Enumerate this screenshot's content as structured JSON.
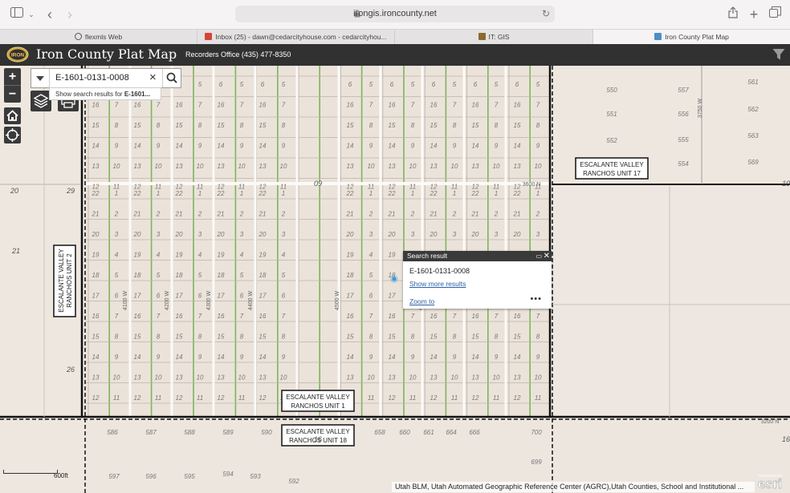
{
  "browser": {
    "url": "irongis.ironcounty.net",
    "tabs": [
      {
        "label": "flexmls Web"
      },
      {
        "label": "Inbox (25) - dawn@cedarcityhouse.com - cedarcityhou..."
      },
      {
        "label": "IT: GIS"
      },
      {
        "label": "Iron County Plat Map"
      }
    ]
  },
  "header": {
    "logo_text": "IRON",
    "title": "Iron County Plat Map",
    "subtitle": "Recorders Office (435) 477-8350"
  },
  "search": {
    "value": "E-1601-0131-0008",
    "suggestion_prefix": "Show search results for ",
    "suggestion_term": "E-1601..."
  },
  "popup": {
    "header": "Search result",
    "title": "E-1601-0131-0008",
    "more_link": "Show more results",
    "zoom_link": "Zoom to",
    "menu": "•••"
  },
  "map": {
    "subdivision_labels": [
      {
        "line1": "ESCALANTE VALLEY",
        "line2": "RANCHOS UNIT 17"
      },
      {
        "line1": "ESCALANTE VALLEY",
        "line2": "RANCHOS UNIT 2"
      },
      {
        "line1": "ESCALANTE VALLEY",
        "line2": "RANCHOS UNIT 1"
      },
      {
        "line1": "ESCALANTE VALLEY",
        "line2": "RANCHOS UNIT 18"
      }
    ],
    "section_numbers": [
      "20",
      "29",
      "21",
      "28",
      "26",
      "09",
      "16"
    ],
    "lot_numbers_unit17": [
      "561",
      "550",
      "557",
      "562",
      "551",
      "556",
      "563",
      "552",
      "555",
      "554",
      "569"
    ],
    "lot_numbers_unit18": [
      "586",
      "587",
      "588",
      "589",
      "590",
      "658",
      "660",
      "661",
      "664",
      "666",
      "700",
      "699",
      "597",
      "596",
      "595",
      "594",
      "593",
      "592"
    ],
    "road_labels": [
      "3600 N",
      "3200 N",
      "3750 W",
      "4100 W",
      "4200 W",
      "4300 W",
      "4400 W",
      "4500 W",
      "4600 W"
    ],
    "edge_labels": [
      "10",
      "16"
    ],
    "scale": "600ft",
    "attribution": "Utah BLM, Utah Automated Geographic Reference Center (AGRC),Utah Counties, School and Institutional ...",
    "esri_text": "esri",
    "esri_powered": "POWERED BY"
  }
}
